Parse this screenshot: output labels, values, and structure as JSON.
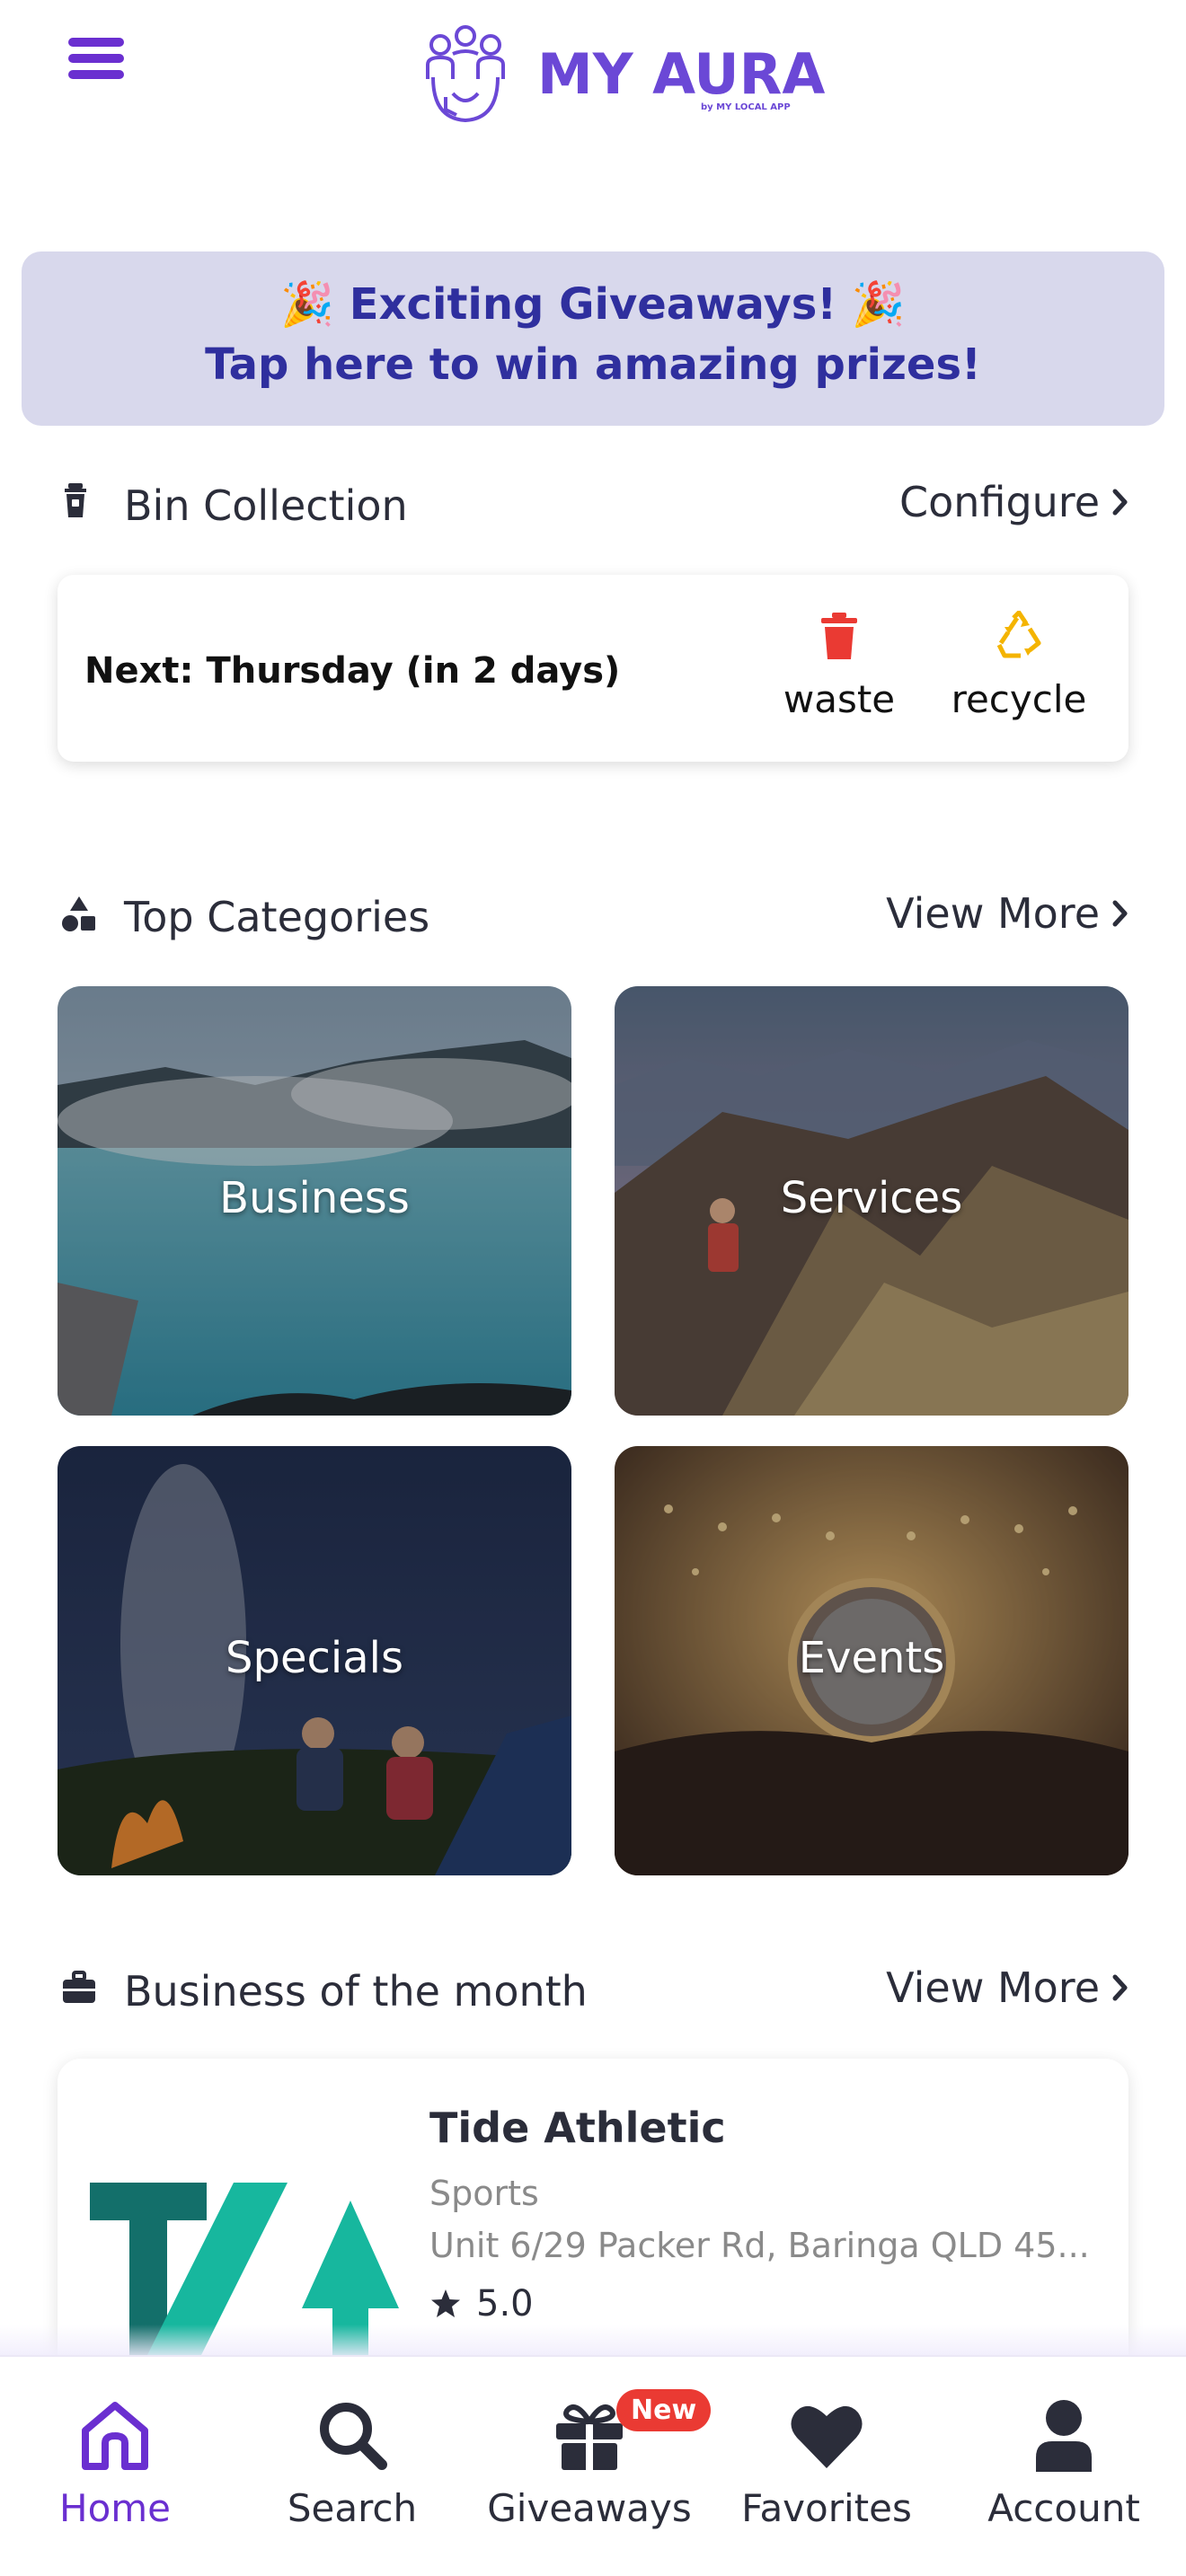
{
  "header": {
    "logo_text": "MY AURA",
    "logo_sub": "by MY LOCAL APP",
    "menu_icon": "hamburger-menu-icon"
  },
  "banner": {
    "line1": "🎉 Exciting Giveaways! 🎉",
    "line2": "Tap here to win amazing prizes!",
    "background": "#d8d8ec",
    "text_color": "#2f2f9e"
  },
  "bin_section": {
    "title": "Bin Collection",
    "link": "Configure",
    "next": "Next: Thursday (in 2 days)",
    "types": [
      {
        "label": "waste",
        "icon": "trash-can-icon",
        "color": "#ea3a33"
      },
      {
        "label": "recycle",
        "icon": "recycle-icon",
        "color": "#f4b400"
      }
    ]
  },
  "categories_section": {
    "title": "Top Categories",
    "link": "View More",
    "items": [
      {
        "label": "Business"
      },
      {
        "label": "Services"
      },
      {
        "label": "Specials"
      },
      {
        "label": "Events"
      }
    ]
  },
  "business_section": {
    "title": "Business of the month",
    "link": "View More",
    "business": {
      "name": "Tide Athletic",
      "category": "Sports",
      "address": "Unit 6/29 Packer Rd, Baringa QLD 45...",
      "rating": "5.0"
    }
  },
  "bottom_nav": {
    "items": [
      {
        "label": "Home",
        "icon": "home-icon",
        "active": true
      },
      {
        "label": "Search",
        "icon": "search-icon"
      },
      {
        "label": "Giveaways",
        "icon": "gift-icon",
        "badge": "New"
      },
      {
        "label": "Favorites",
        "icon": "heart-icon"
      },
      {
        "label": "Account",
        "icon": "user-icon"
      }
    ]
  },
  "colors": {
    "accent": "#6a2fd0",
    "brand": "#6b48d6",
    "badge": "#ea3a33"
  }
}
